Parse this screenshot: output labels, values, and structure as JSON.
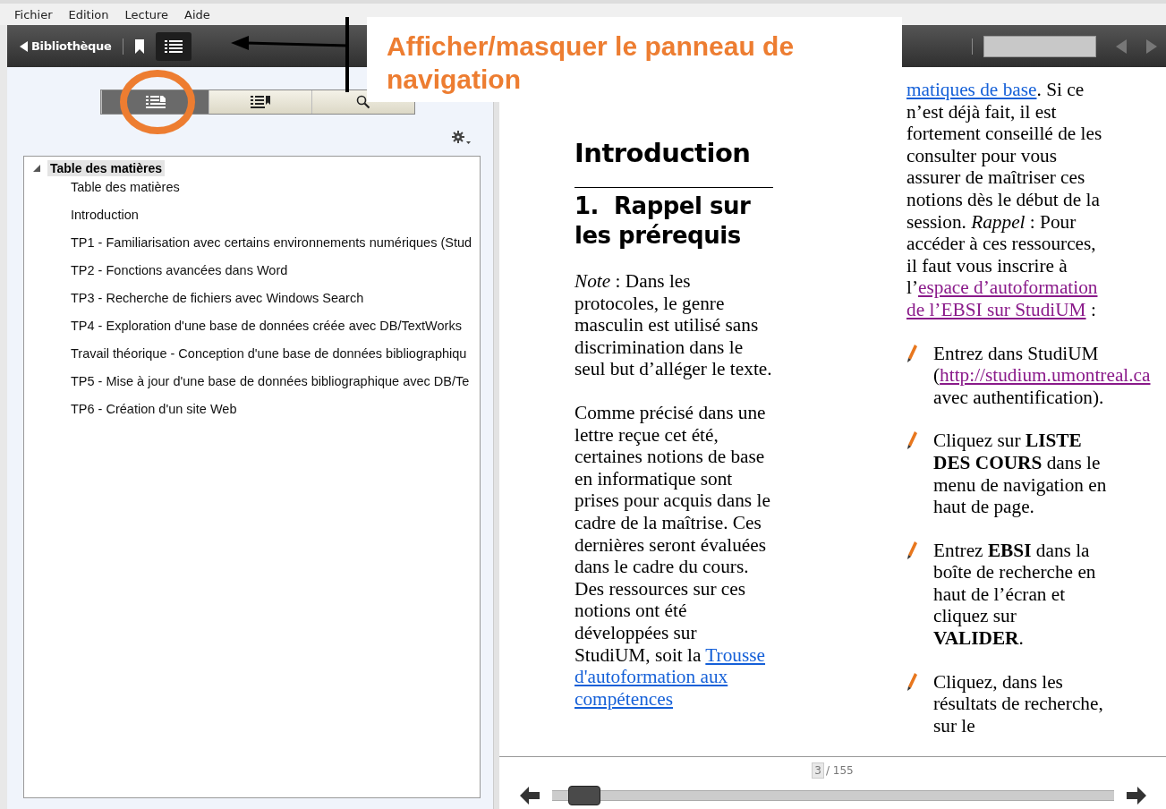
{
  "menu": [
    "Fichier",
    "Edition",
    "Lecture",
    "Aide"
  ],
  "toolbar": {
    "library_button": "Bibliothèque",
    "toc_toggle": {
      "on": true
    }
  },
  "nav_tabs": [
    {
      "kind": "contents",
      "selected": true
    },
    {
      "kind": "bookmarks",
      "selected": false
    },
    {
      "kind": "search",
      "selected": false
    }
  ],
  "toc": {
    "label": "Table des matières",
    "expanded": true,
    "selected": true,
    "children": [
      {
        "label": "Table des matières",
        "selected": false
      },
      {
        "label": "Introduction",
        "selected": false
      },
      {
        "label": "TP1 - Familiarisation avec certains environnements numériques (Stud",
        "selected": false
      },
      {
        "label": "TP2 - Fonctions avancées dans Word",
        "selected": false
      },
      {
        "label": "TP3 - Recherche de fichiers avec Windows Search",
        "selected": false
      },
      {
        "label": "TP4 - Exploration d'une base de données créée avec DB/TextWorks",
        "selected": false
      },
      {
        "label": "Travail théorique - Conception d'une base de données bibliographiqu",
        "selected": false
      },
      {
        "label": "TP5 - Mise à jour d'une base de données bibliographique avec DB/Te",
        "selected": false
      },
      {
        "label": "TP6 - Création d'un site Web",
        "selected": false
      }
    ]
  },
  "document": {
    "heading": "Introduction",
    "subheading": "1.  Rappel sur les prérequis",
    "column_1": [
      [
        {
          "kind": "text",
          "text": "*Note*  : Dans les protocoles, le genre masculin est utilisé sans discrimination dans le seul but d’alléger le texte."
        }
      ],
      [
        {
          "kind": "text",
          "text": "Comme précisé dans une lettre reçue cet été, certaines notions de base en informatique sont prises pour acquis dans le cadre de la maîtrise. Ces dernières seront évaluées dans le cadre du cours. Des ressources sur ces notions ont été développées sur StudiUM, soit la "
        },
        {
          "kind": "link",
          "text": "Trousse"
        },
        {
          "kind": "link",
          "text": "d'autoformation aux"
        },
        {
          "kind": "link",
          "text": "compétences"
        }
      ]
    ],
    "column_2": [
      {
        "kind": "paragraph",
        "segments": [
          {
            "kind": "link",
            "text": "matiques de base"
          },
          {
            "kind": "text",
            "text": ". Si ce n’est déjà fait, il est fortement conseillé de les consulter pour vous assurer de maîtriser ces notions dès le début de la session. *Rappel* : Pour accéder à ces ressources, il faut vous inscrire à l’"
          },
          {
            "kind": "visited_link",
            "text": "espace d’autoformation"
          },
          {
            "kind": "visited_link",
            "text": "de l’EBSI sur StudiUM"
          },
          {
            "kind": "text",
            "text": " :"
          }
        ]
      },
      {
        "kind": "bullet",
        "segments": [
          {
            "kind": "text",
            "text": "Entrez dans StudiUM ("
          },
          {
            "kind": "visited_link",
            "text": "http://studium.umontreal.ca"
          },
          {
            "kind": "text",
            "text": " avec authentification)."
          }
        ]
      },
      {
        "kind": "bullet",
        "segments": [
          {
            "kind": "text",
            "text": "Cliquez sur **LISTE DES COURS** dans le menu de navigation en haut de page."
          }
        ]
      },
      {
        "kind": "bullet",
        "segments": [
          {
            "kind": "text",
            "text": "Entrez **EBSI** dans la boîte de recherche en haut de l’écran et cliquez sur **VALIDER**."
          }
        ]
      },
      {
        "kind": "bullet",
        "segments": [
          {
            "kind": "text",
            "text": "Cliquez, dans les résultats de recherche, sur le"
          }
        ]
      }
    ]
  },
  "footer": {
    "page": "3",
    "total": "/ 155",
    "slider": {
      "level": 0.03
    }
  },
  "annotation": {
    "text": "Afficher/masquer le panneau de navigation"
  }
}
